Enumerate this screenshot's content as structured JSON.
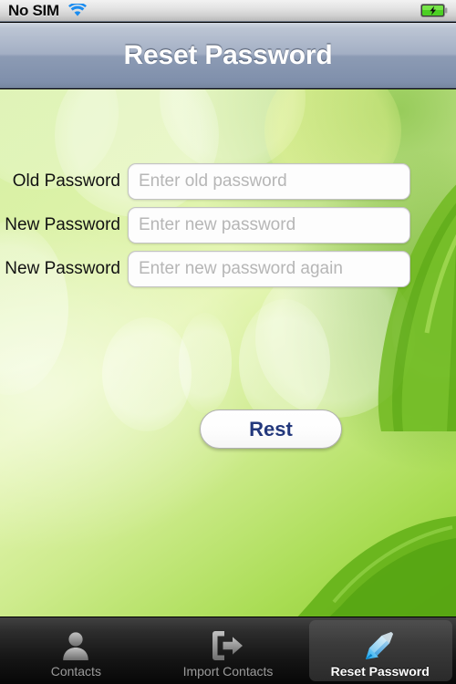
{
  "status_bar": {
    "carrier": "No SIM",
    "wifi_icon": "wifi-icon",
    "battery_icon": "battery-charging-icon",
    "wifi_color": "#1a8cf0",
    "battery_color": "#4cd024"
  },
  "nav_bar": {
    "title": "Reset Password"
  },
  "form": {
    "fields": [
      {
        "label": "Old Password",
        "placeholder": "Enter old password",
        "value": ""
      },
      {
        "label": "New Password",
        "placeholder": "Enter new password",
        "value": ""
      },
      {
        "label": "New Password",
        "placeholder": "Enter new password again",
        "value": ""
      }
    ],
    "submit_label": "Rest",
    "submit_color": "#23387c"
  },
  "tab_bar": {
    "items": [
      {
        "label": "Contacts",
        "icon": "person-icon",
        "active": false
      },
      {
        "label": "Import Contacts",
        "icon": "import-arrow-icon",
        "active": false
      },
      {
        "label": "Reset Password",
        "icon": "blue-pencil-icon",
        "active": true
      }
    ]
  },
  "theme": {
    "accent": "#8ecb32",
    "nav_bar_color": "#8c9bb4",
    "tab_bar_color": "#161616"
  }
}
